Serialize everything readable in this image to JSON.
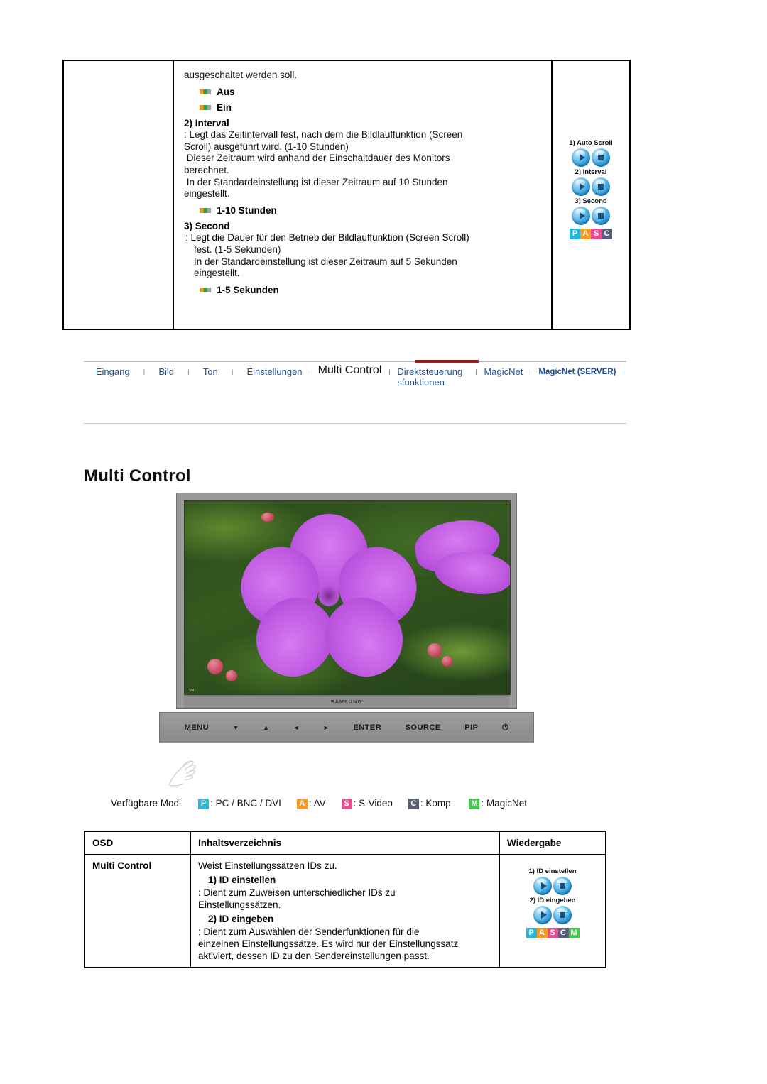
{
  "spec_panel": {
    "intro_text": "ausgeschaltet werden soll.",
    "bullets_1": [
      {
        "icon": "square-bullet-icon",
        "label": "Aus"
      },
      {
        "icon": "square-bullet-icon",
        "label": "Ein"
      }
    ],
    "section_2_heading": "2) Interval",
    "section_2_lines": [
      ": Legt das Zeitintervall fest, nach dem die Bildlauffunktion (Screen",
      "Scroll) ausgeführt wird. (1-10 Stunden)",
      " Dieser Zeitraum wird anhand der Einschaltdauer des Monitors",
      "berechnet.",
      " In der Standardeinstellung ist dieser Zeitraum auf 10 Stunden",
      "eingestellt."
    ],
    "bullets_2": [
      {
        "icon": "square-bullet-icon",
        "label": "1-10 Stunden"
      }
    ],
    "section_3_heading": "3) Second",
    "section_3_lines": [
      ":  Legt die Dauer für den Betrieb der Bildlauffunktion (Screen Scroll)",
      "fest. (1-5 Sekunden)",
      "In der Standardeinstellung ist dieser Zeitraum auf 5 Sekunden",
      "eingestellt."
    ],
    "bullets_3": [
      {
        "icon": "square-bullet-icon",
        "label": "1-5 Sekunden"
      }
    ],
    "remote_groups": [
      {
        "caption": "1) Auto Scroll"
      },
      {
        "caption": "2) Interval"
      },
      {
        "caption": "3) Second"
      }
    ],
    "pasc_badge": [
      "P",
      "A",
      "S",
      "C"
    ]
  },
  "nav": {
    "items": [
      {
        "label": "Eingang",
        "active": false
      },
      {
        "label": "Bild",
        "active": false
      },
      {
        "label": "Ton",
        "active": false
      },
      {
        "label": "Einstellungen",
        "active": false
      },
      {
        "label": "Multi Control",
        "active": true
      },
      {
        "label": "Direktsteuerung sfunktionen",
        "active": false
      },
      {
        "label": "MagicNet",
        "active": false
      },
      {
        "label": "MagicNet (SERVER)",
        "active": false
      }
    ],
    "separator": "I",
    "active_underline_color": "#a81919",
    "link_color": "#1f4e96"
  },
  "page": {
    "title": "Multi Control"
  },
  "monitor": {
    "brand": "SAMSUNG",
    "side_label": "SN",
    "controls": [
      "MENU",
      "▼",
      "▲",
      "◄",
      "►",
      "ENTER",
      "SOURCE",
      "PIP",
      "⏻"
    ],
    "hand_icon": "hand-pointer-icon"
  },
  "modes": {
    "lead": "Verfügbare Modi",
    "items": [
      {
        "chip": "P",
        "color": "#29b6d8",
        "label": ": PC / BNC / DVI"
      },
      {
        "chip": "A",
        "color": "#f59a23",
        "label": ": AV"
      },
      {
        "chip": "S",
        "color": "#e64a91",
        "label": ": S-Video"
      },
      {
        "chip": "C",
        "color": "#5a5f7a",
        "label": ": Komp."
      },
      {
        "chip": "M",
        "color": "#44c94a",
        "label": ": MagicNet"
      }
    ]
  },
  "osd_table": {
    "headers": [
      "OSD",
      "Inhaltsverzeichnis",
      "Wiedergabe"
    ],
    "row": {
      "osd": "Multi Control",
      "intro": "Weist Einstellungssätzen IDs zu.",
      "sub1_heading": "1) ID einstellen",
      "sub1_lines": [
        ": Dient zum Zuweisen unterschiedlicher IDs zu",
        "Einstellungssätzen."
      ],
      "sub2_heading": "2) ID eingeben",
      "sub2_lines": [
        ": Dient zum Auswählen der Senderfunktionen für die",
        "einzelnen Einstellungssätze. Es wird nur der Einstellungssatz",
        "aktiviert, dessen ID zu den Sendereinstellungen passt."
      ],
      "remote_groups": [
        {
          "caption": "1) ID einstellen"
        },
        {
          "caption": "2) ID eingeben"
        }
      ],
      "pasc_badge": [
        "P",
        "A",
        "S",
        "C",
        "M"
      ]
    }
  }
}
